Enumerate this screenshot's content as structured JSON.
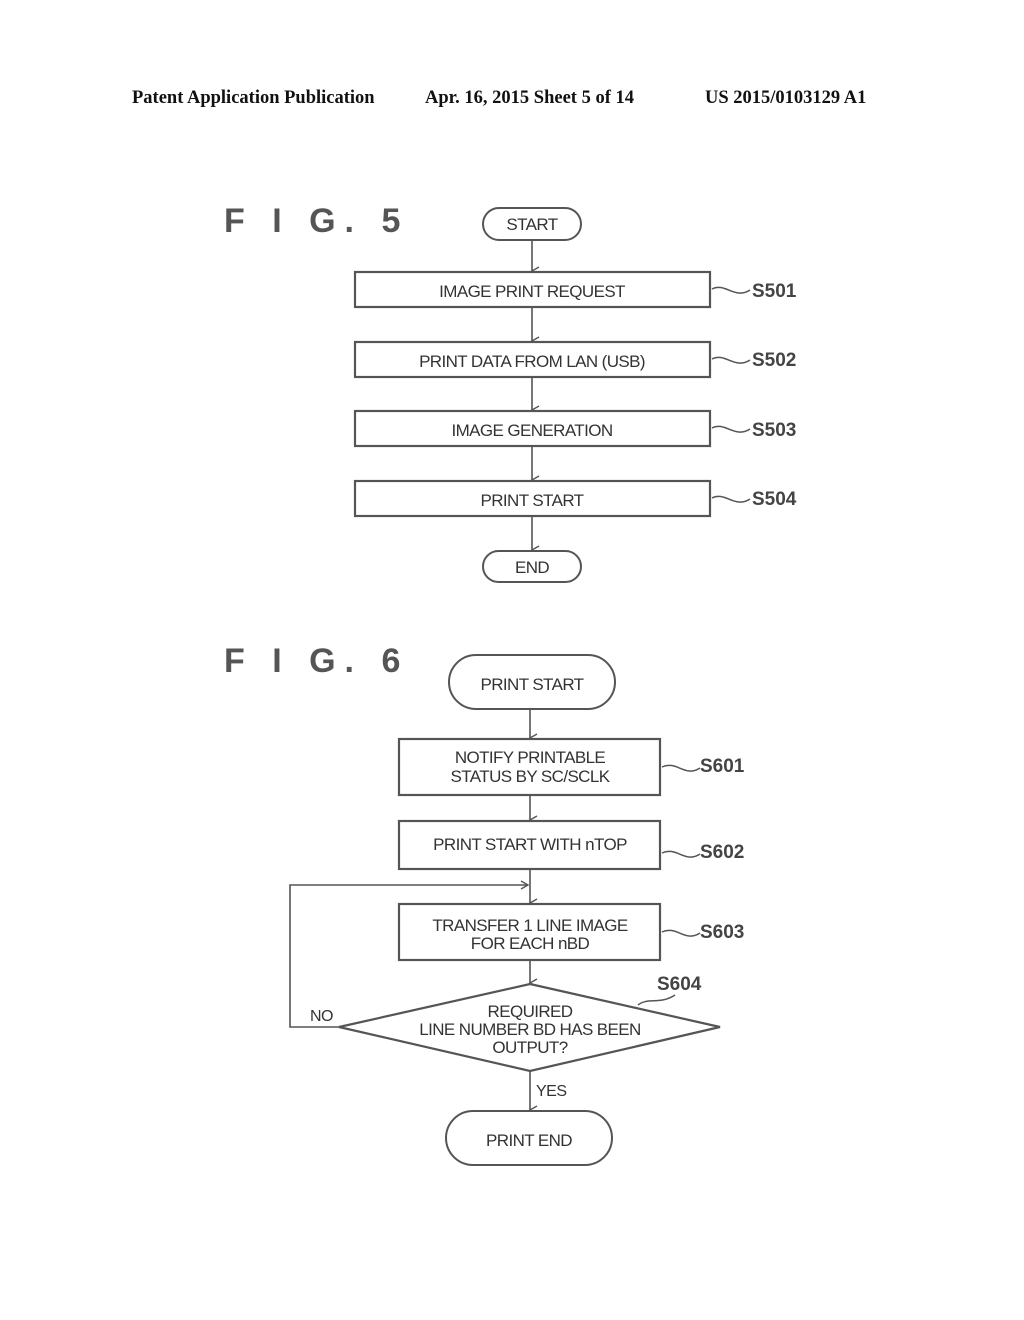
{
  "header": {
    "left": "Patent Application Publication",
    "middle": "Apr. 16, 2015  Sheet 5 of 14",
    "right": "US 2015/0103129 A1"
  },
  "fig5": {
    "title": "F I G.  5",
    "start": "START",
    "steps": [
      {
        "id": "S501",
        "lines": [
          "IMAGE PRINT REQUEST"
        ]
      },
      {
        "id": "S502",
        "lines": [
          "PRINT DATA FROM LAN (USB)"
        ]
      },
      {
        "id": "S503",
        "lines": [
          "IMAGE GENERATION"
        ]
      },
      {
        "id": "S504",
        "lines": [
          "PRINT START"
        ]
      }
    ],
    "end": "END"
  },
  "fig6": {
    "title": "F I G.  6",
    "start": "PRINT START",
    "steps": [
      {
        "id": "S601",
        "lines": [
          "NOTIFY PRINTABLE",
          "STATUS BY SC/SCLK"
        ]
      },
      {
        "id": "S602",
        "lines": [
          "PRINT START WITH nTOP"
        ]
      },
      {
        "id": "S603",
        "lines": [
          "TRANSFER 1 LINE IMAGE",
          "FOR EACH nBD"
        ]
      }
    ],
    "decision": {
      "id": "S604",
      "lines": [
        "REQUIRED",
        "LINE NUMBER BD HAS BEEN",
        "OUTPUT?"
      ]
    },
    "no_label": "NO",
    "yes_label": "YES",
    "end": "PRINT END"
  }
}
